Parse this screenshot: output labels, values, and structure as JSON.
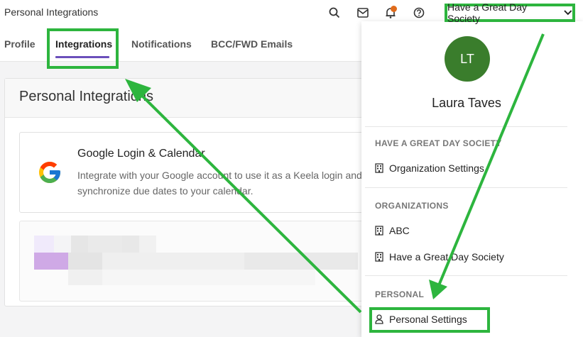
{
  "app": {
    "title": "Personal Integrations"
  },
  "topbar": {
    "icons": [
      "search-icon",
      "mail-icon",
      "bell-icon",
      "help-icon"
    ],
    "org_menu_label": "Have a Great Day Society"
  },
  "tabs": [
    {
      "label": "Profile",
      "active": false
    },
    {
      "label": "Integrations",
      "active": true
    },
    {
      "label": "Notifications",
      "active": false
    },
    {
      "label": "BCC/FWD Emails",
      "active": false
    }
  ],
  "main": {
    "card_title": "Personal Integrations",
    "integration": {
      "title": "Google Login & Calendar",
      "description": "Integrate with your Google account to use it as a Keela login and synchronize due dates to your calendar."
    }
  },
  "dropdown": {
    "avatar_initials": "LT",
    "user_name": "Laura Taves",
    "sections": [
      {
        "heading": "HAVE A GREAT DAY SOCIETY",
        "items": [
          {
            "label": "Organization Settings",
            "icon": "building-icon"
          }
        ]
      },
      {
        "heading": "ORGANIZATIONS",
        "items": [
          {
            "label": "ABC",
            "icon": "building-icon"
          },
          {
            "label": "Have a Great Day Society",
            "icon": "building-icon"
          }
        ]
      },
      {
        "heading": "PERSONAL",
        "items": [
          {
            "label": "Personal Settings",
            "icon": "person-icon"
          }
        ]
      }
    ]
  },
  "colors": {
    "accent": "#6b4fbb",
    "highlight": "#2db53e",
    "avatar": "#3a7d2c",
    "notification": "#e06b1b"
  }
}
